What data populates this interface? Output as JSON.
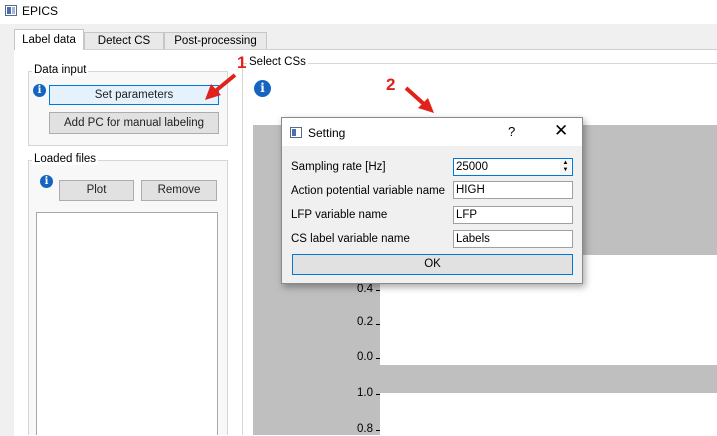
{
  "window": {
    "title": "EPICS",
    "icon": "app-icon"
  },
  "tabs": [
    {
      "label": "Label data",
      "active": true
    },
    {
      "label": "Detect CS",
      "active": false
    },
    {
      "label": "Post-processing",
      "active": false
    }
  ],
  "data_input": {
    "title": "Data input",
    "set_parameters": "Set parameters",
    "add_pc": "Add PC for manual labeling"
  },
  "loaded_files": {
    "title": "Loaded files",
    "plot": "Plot",
    "remove": "Remove"
  },
  "select_css": {
    "title": "Select CSs"
  },
  "info_icon_glyph": "i",
  "annotations": {
    "marker1": "1",
    "marker2": "2",
    "color": "#e0221b"
  },
  "plot": {
    "y_ticks_upper": [
      "0.4",
      "0.2",
      "0.0"
    ],
    "y_ticks_lower": [
      "1.0",
      "0.8"
    ]
  },
  "dialog": {
    "title": "Setting",
    "help": "?",
    "close": "✕",
    "fields": [
      {
        "label": "Sampling rate [Hz]",
        "value": "25000",
        "spinner": true
      },
      {
        "label": "Action potential variable name",
        "value": "HIGH"
      },
      {
        "label": "LFP variable name",
        "value": "LFP"
      },
      {
        "label": "CS label variable name",
        "value": "Labels"
      }
    ],
    "ok": "OK"
  },
  "colors": {
    "accent": "#0078d7",
    "info": "#1565c0",
    "plot_bg": "#bfbfbf"
  }
}
